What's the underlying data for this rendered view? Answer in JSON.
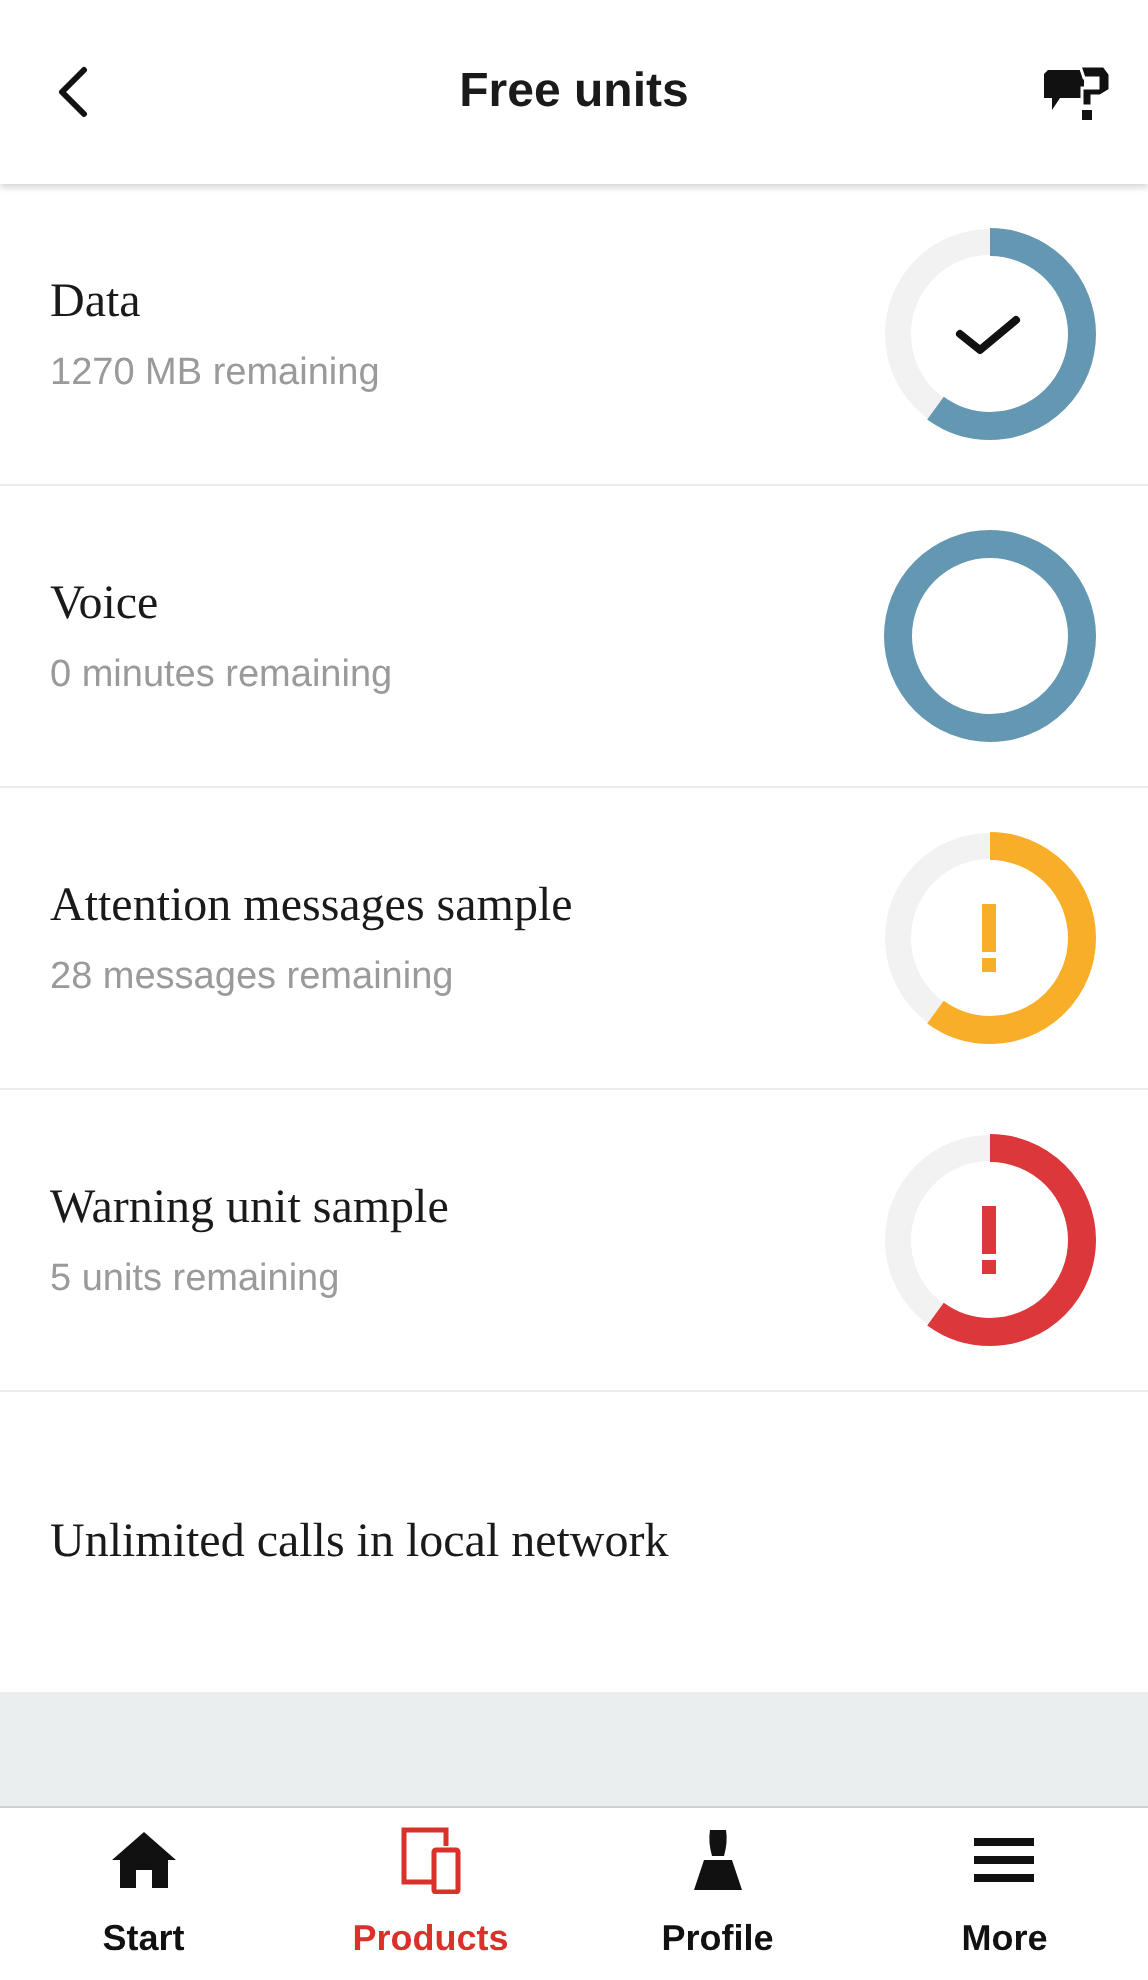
{
  "header": {
    "title": "Free units"
  },
  "units": [
    {
      "kind": "check",
      "title": "Data",
      "subtitle": "1270 MB remaining",
      "level": 0.6,
      "color": "#6497b1"
    },
    {
      "kind": "ring",
      "title": "Voice",
      "subtitle": "0 minutes remaining",
      "level": 1,
      "color": "#6497b1"
    },
    {
      "kind": "alert",
      "title": "Attention messages sample",
      "subtitle": "28 messages remaining",
      "level": 0.6,
      "color": "#f9ae2a"
    },
    {
      "kind": "alert",
      "title": "Warning unit sample",
      "subtitle": "5 units remaining",
      "level": 0.6,
      "color": "#dc373b"
    },
    {
      "kind": "plain",
      "title": "Unlimited calls in local network"
    }
  ],
  "tabs": [
    {
      "label": "Start",
      "kind": "home",
      "selected": false
    },
    {
      "label": "Products",
      "kind": "devices",
      "selected": true
    },
    {
      "label": "Profile",
      "kind": "person",
      "selected": false
    },
    {
      "label": "More",
      "kind": "menu",
      "selected": false
    }
  ]
}
